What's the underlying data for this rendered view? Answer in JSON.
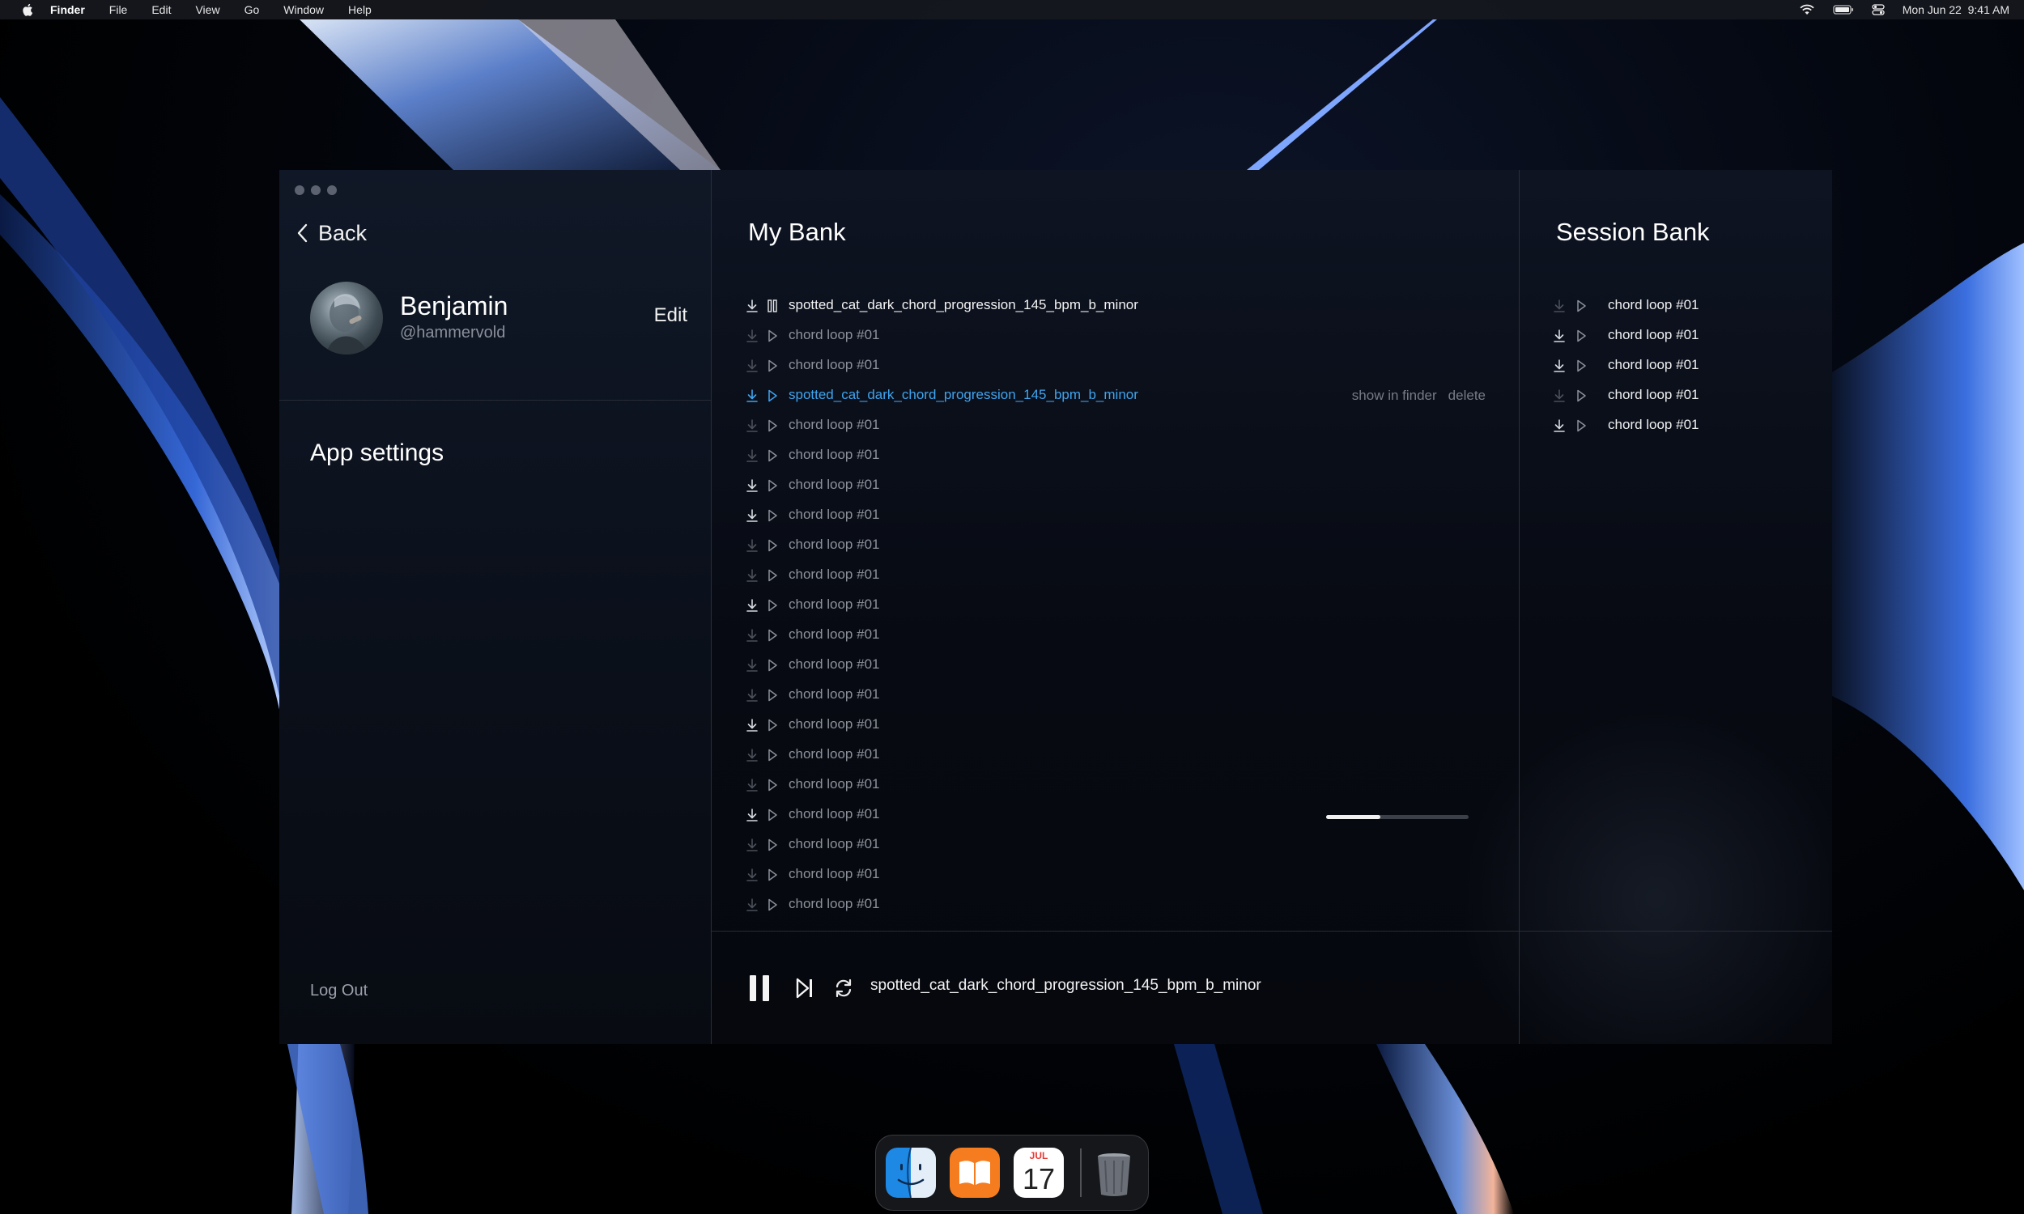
{
  "menubar": {
    "app_name": "Finder",
    "menus": [
      "File",
      "Edit",
      "View",
      "Go",
      "Window",
      "Help"
    ],
    "datetime": "Mon Jun 22  9:41 AM",
    "status_icons": [
      "wifi-icon",
      "battery-icon",
      "control-center-icon"
    ]
  },
  "sidebar": {
    "back_label": "Back",
    "profile": {
      "name": "Benjamin",
      "handle": "@hammervold",
      "edit_label": "Edit"
    },
    "app_settings_label": "App settings",
    "logout_label": "Log Out"
  },
  "my_bank": {
    "title": "My Bank",
    "tracks": [
      {
        "name": "spotted_cat_dark_chord_progression_145_bpm_b_minor",
        "state": "playing",
        "downloaded": true
      },
      {
        "name": "chord loop #01",
        "state": "idle",
        "downloaded": false
      },
      {
        "name": "chord loop #01",
        "state": "idle",
        "downloaded": false
      },
      {
        "name": "spotted_cat_dark_chord_progression_145_bpm_b_minor",
        "state": "hover",
        "downloaded": true,
        "actions": [
          "show in finder",
          "delete"
        ]
      },
      {
        "name": "chord loop #01",
        "state": "idle",
        "downloaded": false
      },
      {
        "name": "chord loop #01",
        "state": "idle",
        "downloaded": false
      },
      {
        "name": "chord loop #01",
        "state": "idle",
        "downloaded": true
      },
      {
        "name": "chord loop #01",
        "state": "idle",
        "downloaded": true
      },
      {
        "name": "chord loop #01",
        "state": "idle",
        "downloaded": false
      },
      {
        "name": "chord loop #01",
        "state": "idle",
        "downloaded": false
      },
      {
        "name": "chord loop #01",
        "state": "idle",
        "downloaded": true
      },
      {
        "name": "chord loop #01",
        "state": "idle",
        "downloaded": false
      },
      {
        "name": "chord loop #01",
        "state": "idle",
        "downloaded": false
      },
      {
        "name": "chord loop #01",
        "state": "idle",
        "downloaded": false
      },
      {
        "name": "chord loop #01",
        "state": "idle",
        "downloaded": true
      },
      {
        "name": "chord loop #01",
        "state": "idle",
        "downloaded": false
      },
      {
        "name": "chord loop #01",
        "state": "idle",
        "downloaded": false
      },
      {
        "name": "chord loop #01",
        "state": "idle",
        "downloaded": true
      },
      {
        "name": "chord loop #01",
        "state": "idle",
        "downloaded": false
      },
      {
        "name": "chord loop #01",
        "state": "idle",
        "downloaded": false
      },
      {
        "name": "chord loop #01",
        "state": "idle",
        "downloaded": false
      },
      {
        "name": "chord loop #01",
        "state": "idle",
        "downloaded": false
      }
    ]
  },
  "session_bank": {
    "title": "Session Bank",
    "tracks": [
      {
        "name": "chord loop #01",
        "downloaded": false
      },
      {
        "name": "chord loop #01",
        "downloaded": true
      },
      {
        "name": "chord loop #01",
        "downloaded": true
      },
      {
        "name": "chord loop #01",
        "downloaded": false
      },
      {
        "name": "chord loop #01",
        "downloaded": true
      }
    ]
  },
  "player": {
    "now_playing": "spotted_cat_dark_chord_progression_145_bpm_b_minor",
    "progress": 0.38
  },
  "dock": {
    "apps": [
      "finder-icon",
      "books-icon",
      "calendar-icon",
      "trash-icon"
    ],
    "calendar_month": "JUL",
    "calendar_day": "17"
  },
  "colors": {
    "accent_blue": "#3fa4ee",
    "text_primary": "#f4f4f4",
    "text_muted": "#8d929b",
    "window_bg": "#070a12",
    "divider": "#262b35"
  }
}
